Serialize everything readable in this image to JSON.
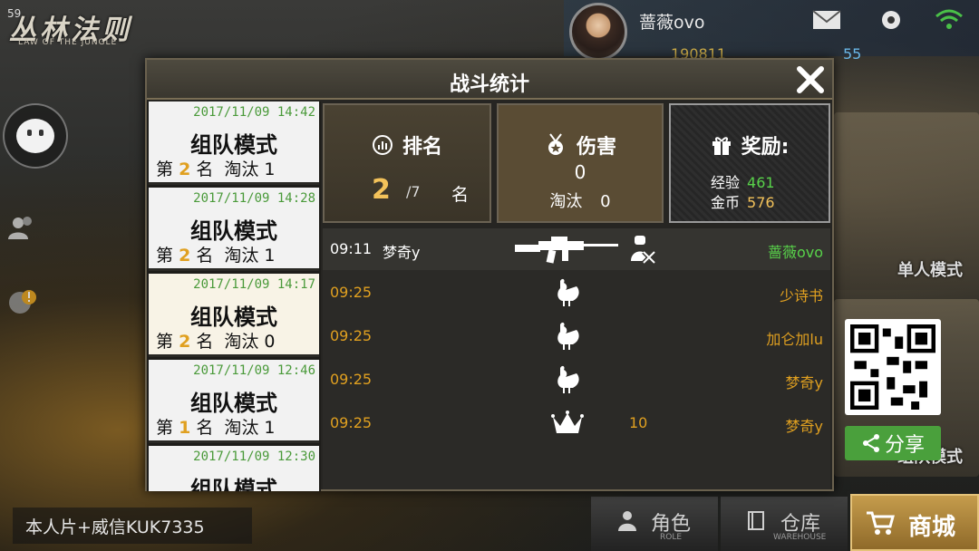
{
  "fps": "59",
  "logo": {
    "title": "丛林法则",
    "subtitle": "LAW OF THE JUNGLE"
  },
  "profile": {
    "username": "蔷薇ovo",
    "coins": "190811",
    "gems": "55"
  },
  "side_menu": {
    "single_mode": "单人模式",
    "team_mode": "组队模式",
    "share_label": "分享"
  },
  "bottom": {
    "chat_input": "本人片+威信KUK7335",
    "role_label": "角色",
    "role_sub": "ROLE",
    "warehouse_label": "仓库",
    "warehouse_sub": "WAREHOUSE",
    "shop_label": "商城"
  },
  "modal": {
    "title": "战斗统计",
    "matches": [
      {
        "date": "2017/11/09 14:42",
        "mode": "组队模式",
        "rank_prefix": "第",
        "rank": "2",
        "rank_suffix": "名",
        "elim_label": "淘汰",
        "elim": "1"
      },
      {
        "date": "2017/11/09 14:28",
        "mode": "组队模式",
        "rank_prefix": "第",
        "rank": "2",
        "rank_suffix": "名",
        "elim_label": "淘汰",
        "elim": "1"
      },
      {
        "date": "2017/11/09 14:17",
        "mode": "组队模式",
        "rank_prefix": "第",
        "rank": "2",
        "rank_suffix": "名",
        "elim_label": "淘汰",
        "elim": "0"
      },
      {
        "date": "2017/11/09 12:46",
        "mode": "组队模式",
        "rank_prefix": "第",
        "rank": "1",
        "rank_suffix": "名",
        "elim_label": "淘汰",
        "elim": "1"
      },
      {
        "date": "2017/11/09 12:30",
        "mode": "组队模式"
      }
    ],
    "stats": {
      "rank_label": "排名",
      "rank_value": "2",
      "rank_total": "/7",
      "rank_unit": "名",
      "damage_label": "伤害",
      "damage_value": "0",
      "elim_label": "淘汰",
      "elim_value": "0",
      "reward_label": "奖励:",
      "exp_label": "经验",
      "exp_value": "461",
      "gold_label": "金币",
      "gold_value": "576"
    },
    "feed": [
      {
        "time": "09:11",
        "killer": "梦奇y",
        "icon": "rifle-kill-icon",
        "count": "",
        "victim": "蔷薇ovo"
      },
      {
        "time": "09:25",
        "killer": "",
        "icon": "chicken-icon",
        "count": "",
        "victim": "少诗书"
      },
      {
        "time": "09:25",
        "killer": "",
        "icon": "chicken-icon",
        "count": "",
        "victim": "加仑加lu"
      },
      {
        "time": "09:25",
        "killer": "",
        "icon": "chicken-icon",
        "count": "",
        "victim": "梦奇y"
      },
      {
        "time": "09:25",
        "killer": "",
        "icon": "crown-icon",
        "count": "10",
        "victim": "梦奇y"
      }
    ]
  }
}
